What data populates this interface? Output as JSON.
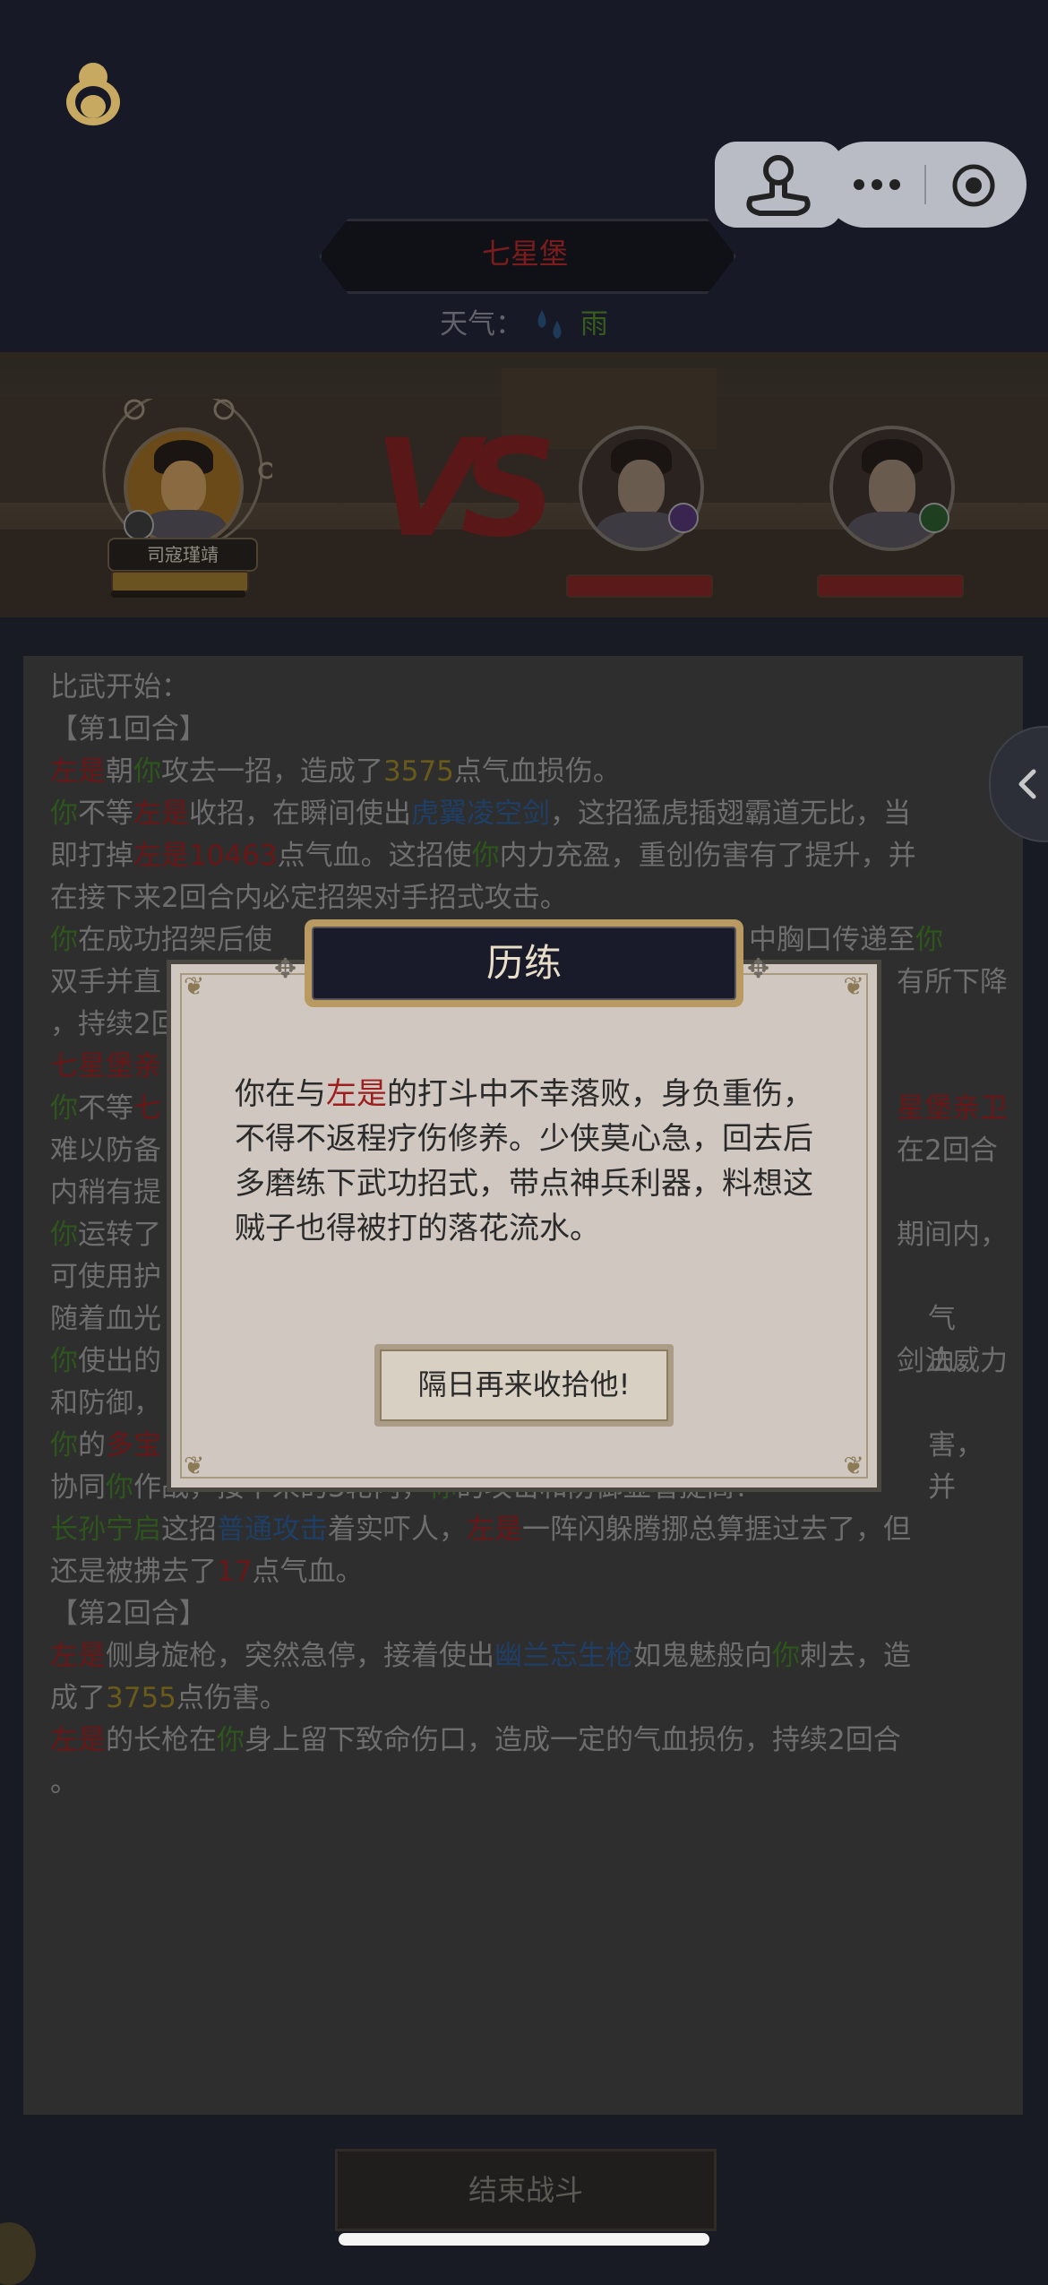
{
  "header": {
    "location": "七星堡",
    "weather_label": "天气：",
    "weather_value": "雨",
    "weather_icon": "rain-drops-icon"
  },
  "battle": {
    "player_name": "司寇瑾靖",
    "vs_label": "VS"
  },
  "log": {
    "start": "比武开始：",
    "round1": "【第1回合】",
    "round2": "【第2回合】",
    "names": {
      "zuoshi": "左是",
      "ni": "你",
      "qixingbao_qinwei": "七星堡亲卫",
      "qixingbao": "七星堡亲",
      "changsun": "长孙宁启",
      "qi": "七",
      "baoqinwei": "星堡亲卫",
      "duobao": "多宝"
    },
    "skills": {
      "huyi": "虎翼凌空剑",
      "putong": "普通攻击",
      "youlan": "幽兰忘生枪"
    },
    "numbers": {
      "n1": "3575",
      "n2": "10463",
      "n3": "17",
      "n4": "3755"
    },
    "text": {
      "l1a": "朝",
      "l1b": "攻去一招，造成了",
      "l1c": "点气血损伤。",
      "l2a": "不等",
      "l2b": "收招，在瞬间使出",
      "l2c": "，这招猛虎插翅霸道无比，当",
      "l3a": "即打掉",
      "l3b": "点气血。这招使",
      "l3c": "内力充盈，重创伤害有了提升，并",
      "l4": "在接下来2回合内必定招架对手招式攻击。",
      "l5a": "在成功招架后使",
      "l5b": "中胸口传递至",
      "l6a": "双手并直",
      "l6b": "有所下降",
      "l7": "，持续2回",
      "l9a": "不等",
      "l10a": "难以防备",
      "l10b": "在2回合",
      "l11": "内稍有提",
      "l12a": "运转了",
      "l12b": "期间内，",
      "l13": "可使用护",
      "l14a": "随着血光",
      "l14b": "气血。",
      "l15a": "使出的",
      "l15b": "剑法威力",
      "l16": "和防御，",
      "l17a": "的",
      "l17b": "害，并",
      "l18a": "协同",
      "l18b": "作战，接下来的3轮内，",
      "l18c": "的攻击和防御显著提高！",
      "l19a": "这招",
      "l19b": "着实吓人，",
      "l19c": "一阵闪躲腾挪总算捱过去了，但",
      "l20a": "还是被拂去了",
      "l20b": "点气血。",
      "l22a": "侧身旋枪，突然急停，接着使出",
      "l22b": "如鬼魅般向",
      "l22c": "刺去，造",
      "l23a": "成了",
      "l23b": "点伤害。",
      "l24a": "的长枪在",
      "l24b": "身上留下致命伤口，造成一定的气血损伤，持续2回合",
      "l25": "。"
    }
  },
  "dialog": {
    "title": "历练",
    "body_1a": "你在与",
    "body_1b": "左是",
    "body_1c": "的打斗中不幸落败，身负重伤，",
    "body_2": "不得不返程疗伤修养。少侠莫心急，回去后",
    "body_3": "多磨练下武功招式，带点神兵利器，料想这",
    "body_4": "贼子也得被打的落花流水。",
    "confirm": "隔日再来收拾他!"
  },
  "footer": {
    "end_button": "结束战斗"
  },
  "colors": {
    "enemy_red": "#6b1616",
    "ally_green": "#2d561c",
    "skill_blue": "#1f3f66",
    "number_yellow": "#6a5a1a",
    "dialog_title_bg": "#1a1b2a",
    "dialog_bg": "#cfc7c0"
  }
}
